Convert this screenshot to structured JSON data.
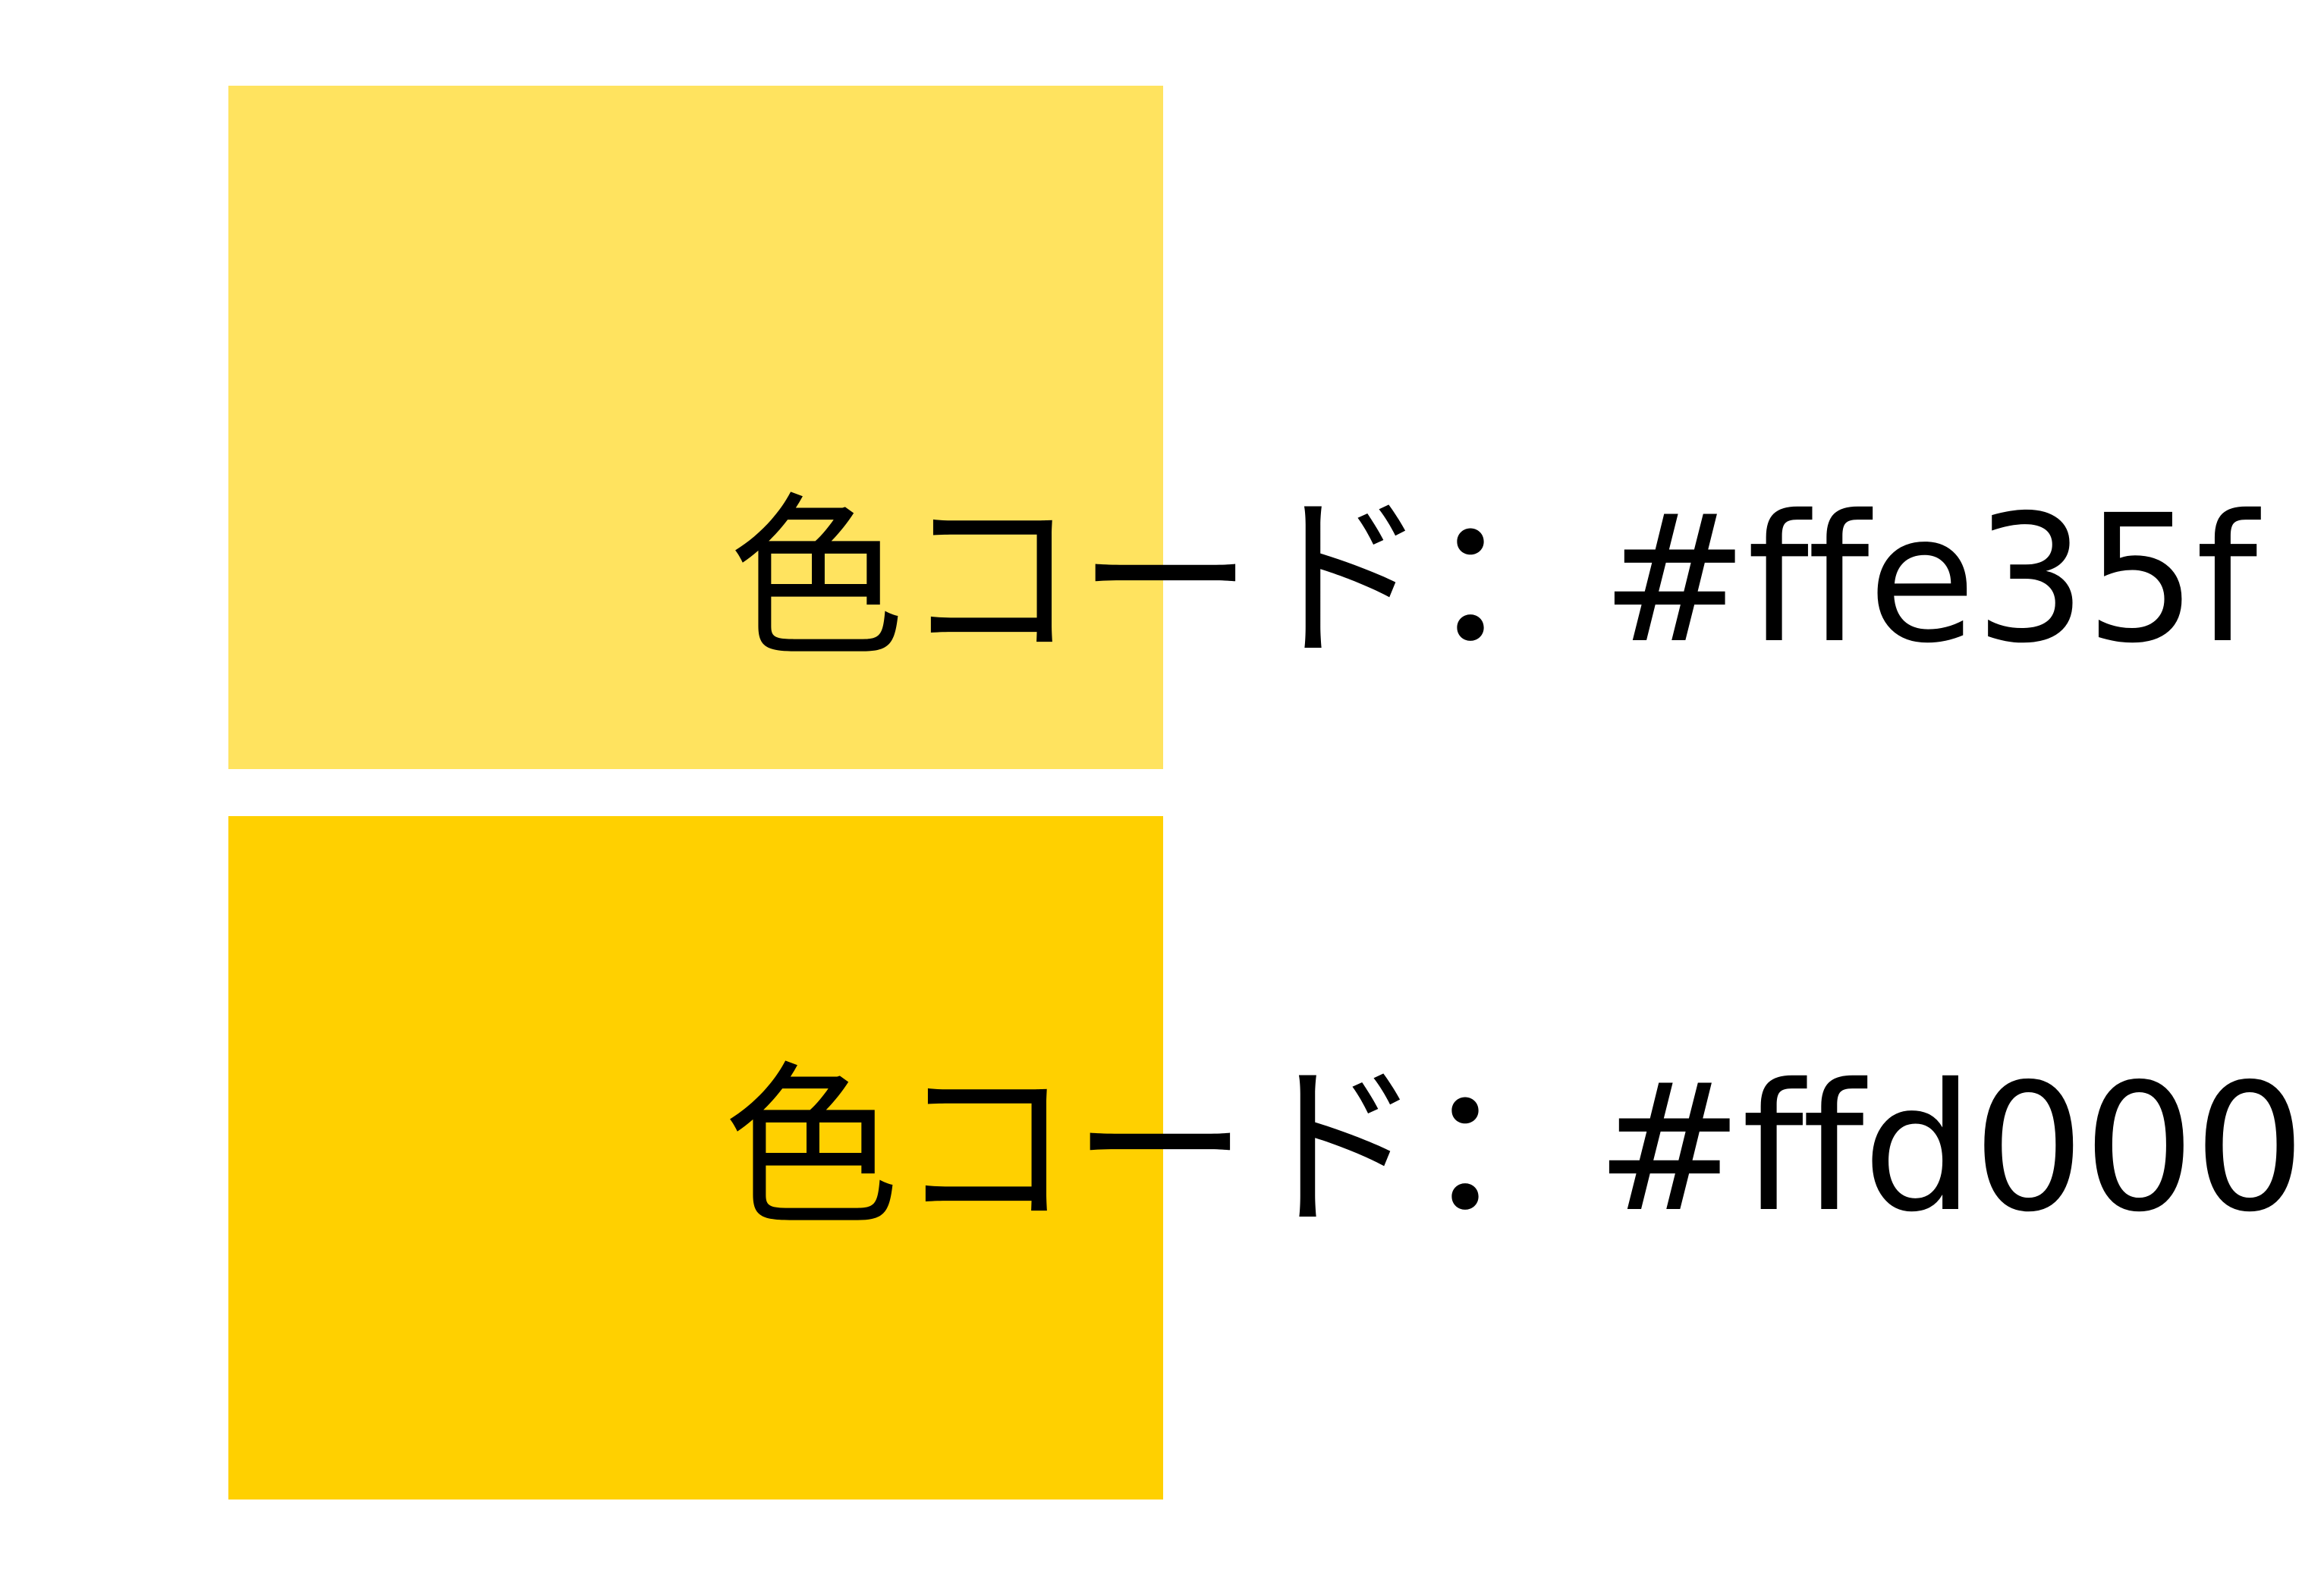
{
  "swatches": [
    {
      "color": "#ffe35f",
      "label": "色コード：#ffe35f"
    },
    {
      "color": "#ffd000",
      "label": "色コード：#ffd000"
    }
  ]
}
